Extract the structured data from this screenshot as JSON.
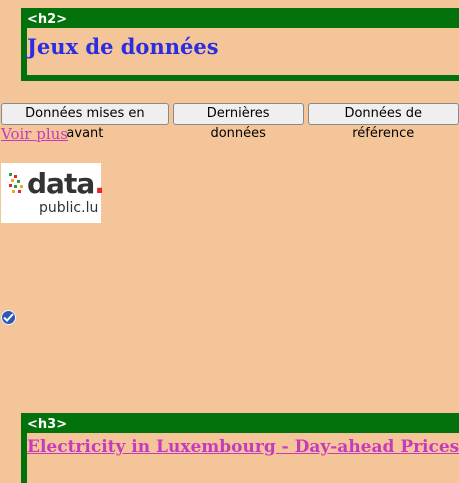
{
  "h2_section": {
    "tag": "<h2>",
    "title": "Jeux de données"
  },
  "tabs": [
    {
      "label": "Données mises en avant"
    },
    {
      "label": "Dernières données"
    },
    {
      "label": "Données de référence"
    }
  ],
  "more_link": "Voir plus",
  "logo": {
    "word": "data",
    "dot": ".",
    "sub": "public.lu"
  },
  "checkbox": {
    "checked": true
  },
  "h3_section": {
    "tag": "<h3>",
    "title": "Electricity in Luxembourg - Day-ahead Prices"
  },
  "colors": {
    "background": "#f5c59a",
    "frame": "#04720c",
    "heading": "#2b2de0",
    "link": "#c63bbd"
  }
}
